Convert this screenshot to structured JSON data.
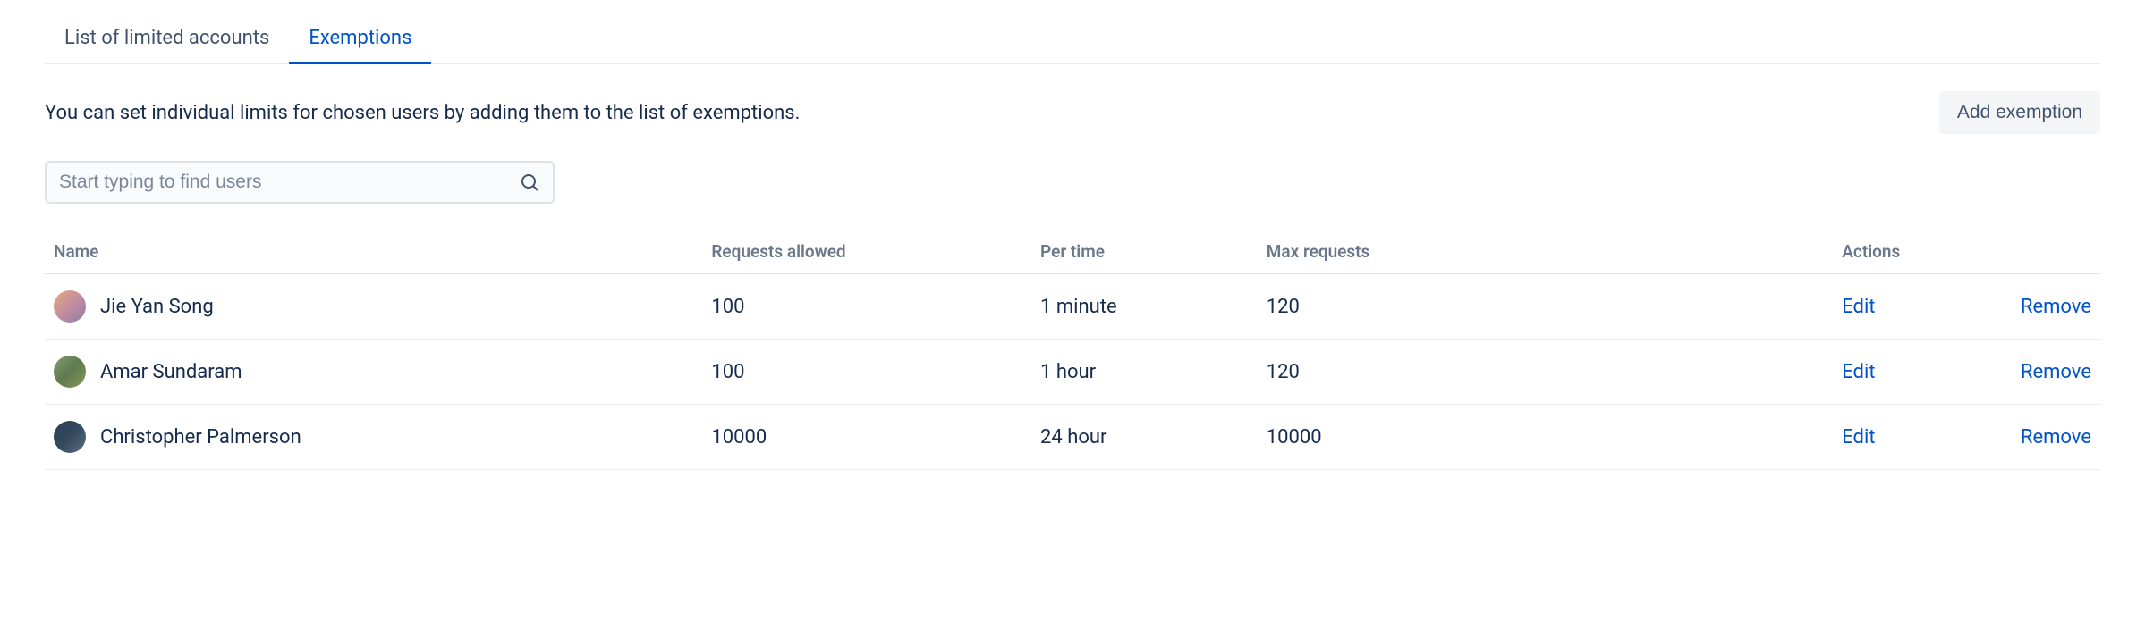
{
  "tabs": {
    "limited": "List of limited accounts",
    "exemptions": "Exemptions"
  },
  "description": "You can set individual limits for chosen users by adding them to the list of exemptions.",
  "add_exemption_label": "Add exemption",
  "search": {
    "placeholder": "Start typing to find users"
  },
  "table": {
    "headers": {
      "name": "Name",
      "requests_allowed": "Requests allowed",
      "per_time": "Per time",
      "max_requests": "Max requests",
      "actions": "Actions"
    },
    "rows": [
      {
        "name": "Jie Yan Song",
        "avatar_bg": "linear-gradient(135deg,#e8a87c 0%,#c38d9e 50%,#8b7dab 100%)",
        "requests_allowed": "100",
        "per_time": "1 minute",
        "max_requests": "120"
      },
      {
        "name": "Amar Sundaram",
        "avatar_bg": "linear-gradient(135deg,#7d9d6f 0%,#5e7a4f 50%,#8a9a5b 100%)",
        "requests_allowed": "100",
        "per_time": "1 hour",
        "max_requests": "120"
      },
      {
        "name": "Christopher Palmerson",
        "avatar_bg": "linear-gradient(135deg,#2c3e50 0%,#34495e 50%,#5d6d7e 100%)",
        "requests_allowed": "10000",
        "per_time": "24 hour",
        "max_requests": "10000"
      }
    ]
  },
  "actions": {
    "edit": "Edit",
    "remove": "Remove"
  }
}
